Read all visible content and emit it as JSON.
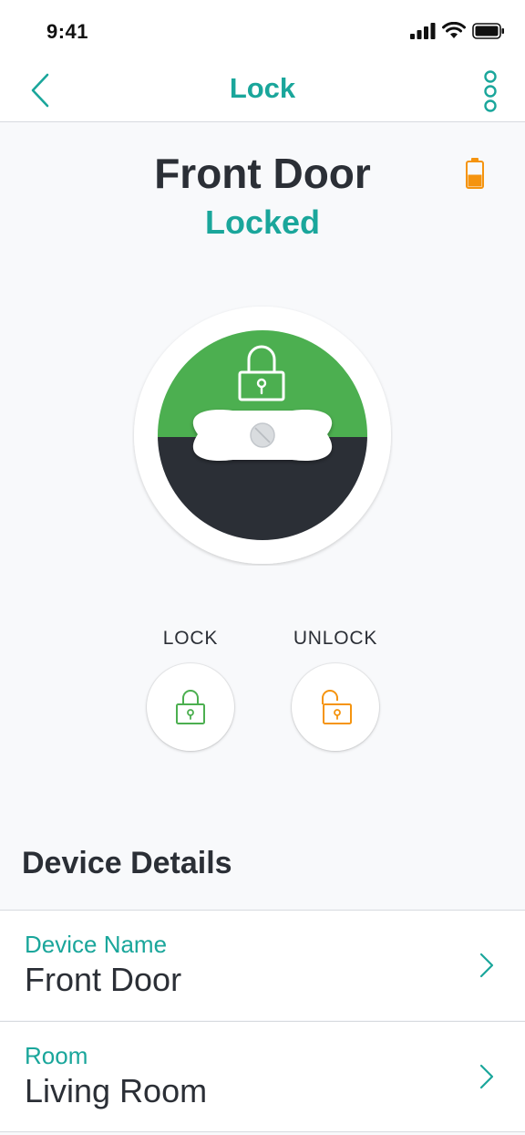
{
  "status_bar": {
    "time": "9:41"
  },
  "header": {
    "title": "Lock",
    "back_icon": "chevron-left-icon",
    "menu_icon": "more-vertical-icon"
  },
  "device": {
    "name": "Front Door",
    "status": "Locked",
    "battery_level": 0.5
  },
  "actions": {
    "lock_label": "LOCK",
    "unlock_label": "UNLOCK"
  },
  "details": {
    "title": "Device Details",
    "rows": [
      {
        "label": "Device Name",
        "value": "Front Door"
      },
      {
        "label": "Room",
        "value": "Living Room"
      }
    ]
  },
  "colors": {
    "accent": "#1aa69b",
    "locked_green": "#4caf50",
    "unlock_orange": "#f5940f",
    "dark": "#2b2f36"
  }
}
